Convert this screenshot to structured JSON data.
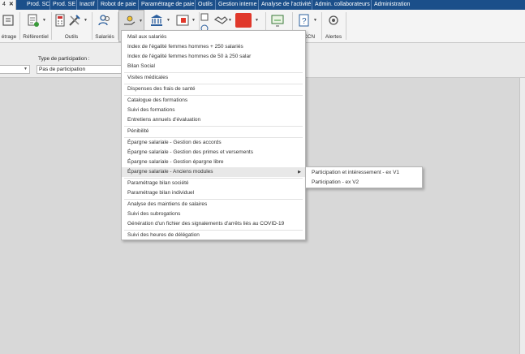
{
  "tabs": [
    {
      "label": "4",
      "active": true
    },
    {
      "label": "Prod. SC"
    },
    {
      "label": "Prod. SE"
    },
    {
      "label": "Inactif"
    },
    {
      "label": "Robot de paie"
    },
    {
      "label": "Paramétrage de paie"
    },
    {
      "label": "Outils"
    },
    {
      "label": "Gestion interne"
    },
    {
      "label": "Analyse de l'activité"
    },
    {
      "label": "Admin. collaborateurs"
    },
    {
      "label": "Administration"
    }
  ],
  "ribbon": {
    "groups": [
      "étrage",
      "Référentiel",
      "Outils",
      "Salariés",
      "CCN",
      "Alertes"
    ]
  },
  "filters": {
    "participation_label": "Type de participation :",
    "participation_value": "Pas de participation"
  },
  "menu": {
    "items": [
      "Mail aux salariés",
      "Index de l'égalité femmes hommes + 250 salariés",
      "Index de l'égalité femmes hommes de 50 à 250 salar",
      "Bilan Social",
      "Visites médicales",
      "Dispenses des frais de santé",
      "Catalogue des formations",
      "Suivi des formations",
      "Entretiens annuels d'évaluation",
      "Pénibilité",
      "Épargne salariale - Gestion des accords",
      "Épargne salariale - Gestion des primes et versements",
      "Épargne salariale - Gestion épargne libre",
      "Épargne salariale - Anciens modules",
      "Paramétrage bilan société",
      "Paramétrage bilan individuel",
      "Analyse des maintiens de salaires",
      "Suivi des subrogations",
      "Génération d'un fichier des signalements d'arrêts liés au COVID-19",
      "Suivi des heures de délégation"
    ],
    "highlighted_index": 13
  },
  "submenu": {
    "items": [
      "Participation et intéressement - ex V1",
      "Participation - ex V2"
    ]
  },
  "colors": {
    "tabbar": "#1b4f8a",
    "accent_red": "#e0382b",
    "icon_blue": "#2b5f9e"
  }
}
